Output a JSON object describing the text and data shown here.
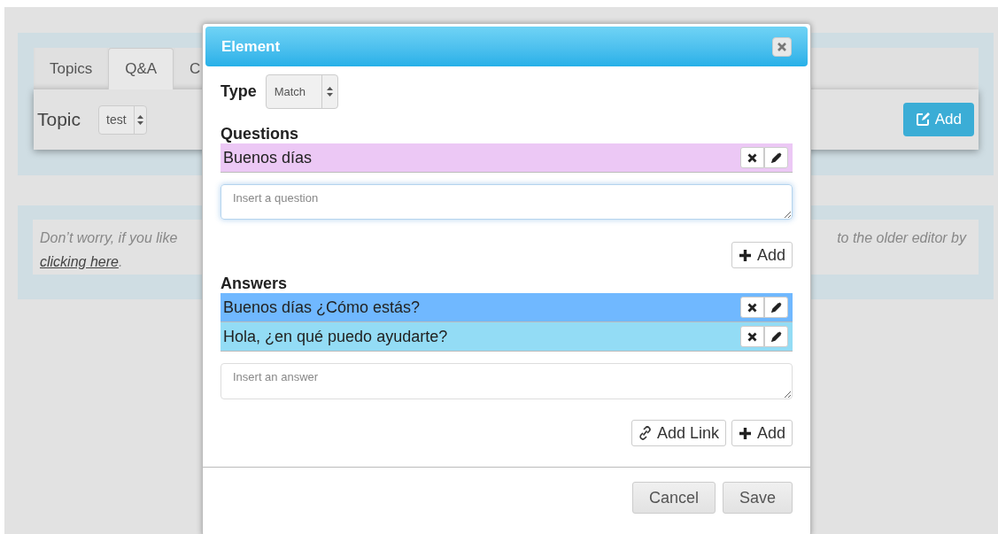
{
  "background": {
    "tabs": [
      {
        "label": "Topics",
        "selected": false
      },
      {
        "label": "Q&A",
        "selected": true
      },
      {
        "label": "C",
        "selected": false
      }
    ],
    "topic": {
      "label": "Topic",
      "value": "test"
    },
    "add_button": "Add",
    "notice": {
      "left": "Don’t worry, if you like",
      "right": "to the older editor by",
      "link": "clicking here",
      "end": "."
    }
  },
  "dialog": {
    "title": "Element",
    "type_label": "Type",
    "type_value": "Match",
    "questions_heading": "Questions",
    "questions": [
      {
        "text": "Buenos días",
        "color": "#ecc8f5"
      }
    ],
    "question_placeholder": "Insert a question",
    "question_focused": true,
    "question_add": "Add",
    "answers_heading": "Answers",
    "answers": [
      {
        "text": "Buenos días ¿Cómo estás?",
        "color": "#70b8ff"
      },
      {
        "text": "Hola, ¿en qué puedo ayudarte?",
        "color": "#93dcf5"
      }
    ],
    "answer_placeholder": "Insert an answer",
    "add_link": "Add Link",
    "answer_add": "Add",
    "buttons": [
      "Cancel",
      "Save"
    ]
  }
}
